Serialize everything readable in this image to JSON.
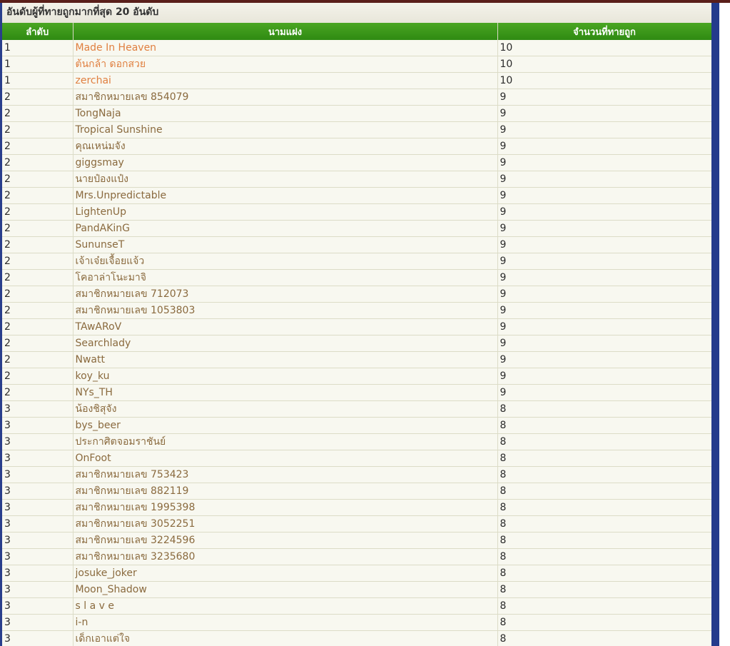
{
  "page": {
    "title": "อันดับผู้ที่ทายถูกมากที่สุด 20 อันดับ"
  },
  "table": {
    "headers": {
      "rank": "ลำดับ",
      "name": "นามแฝง",
      "count": "จำนวนที่ทายถูก"
    },
    "rows": [
      {
        "rank": "1",
        "name": "Made In Heaven",
        "count": "10",
        "highlight": true
      },
      {
        "rank": "1",
        "name": "ต้นกล้า ดอกสวย",
        "count": "10",
        "highlight": true
      },
      {
        "rank": "1",
        "name": "zerchai",
        "count": "10",
        "highlight": true
      },
      {
        "rank": "2",
        "name": "สมาชิกหมายเลข 854079",
        "count": "9"
      },
      {
        "rank": "2",
        "name": "TongNaja",
        "count": "9"
      },
      {
        "rank": "2",
        "name": "Tropical Sunshine",
        "count": "9"
      },
      {
        "rank": "2",
        "name": "คุณเหน่มจัง",
        "count": "9"
      },
      {
        "rank": "2",
        "name": "giggsmay",
        "count": "9"
      },
      {
        "rank": "2",
        "name": "นายป๋องแป๋ง",
        "count": "9"
      },
      {
        "rank": "2",
        "name": "Mrs.Unpredictable",
        "count": "9"
      },
      {
        "rank": "2",
        "name": "LightenUp",
        "count": "9"
      },
      {
        "rank": "2",
        "name": "PandAKinG",
        "count": "9"
      },
      {
        "rank": "2",
        "name": "SununseT",
        "count": "9"
      },
      {
        "rank": "2",
        "name": "เจ้าเจ๋ยเจื้อยแจ้ว",
        "count": "9"
      },
      {
        "rank": "2",
        "name": "โคอาล่าโนะมาจิ",
        "count": "9"
      },
      {
        "rank": "2",
        "name": "สมาชิกหมายเลข 712073",
        "count": "9"
      },
      {
        "rank": "2",
        "name": "สมาชิกหมายเลข 1053803",
        "count": "9"
      },
      {
        "rank": "2",
        "name": "TAwARoV",
        "count": "9"
      },
      {
        "rank": "2",
        "name": "Searchlady",
        "count": "9"
      },
      {
        "rank": "2",
        "name": "Nwatt",
        "count": "9"
      },
      {
        "rank": "2",
        "name": "koy_ku",
        "count": "9"
      },
      {
        "rank": "2",
        "name": "NYs_TH",
        "count": "9"
      },
      {
        "rank": "3",
        "name": "น้องชิสุจัง",
        "count": "8"
      },
      {
        "rank": "3",
        "name": "bys_beer",
        "count": "8"
      },
      {
        "rank": "3",
        "name": "ประกาศิตจอมราชันย์",
        "count": "8"
      },
      {
        "rank": "3",
        "name": "OnFoot",
        "count": "8"
      },
      {
        "rank": "3",
        "name": "สมาชิกหมายเลข 753423",
        "count": "8"
      },
      {
        "rank": "3",
        "name": "สมาชิกหมายเลข 882119",
        "count": "8"
      },
      {
        "rank": "3",
        "name": "สมาชิกหมายเลข 1995398",
        "count": "8"
      },
      {
        "rank": "3",
        "name": "สมาชิกหมายเลข 3052251",
        "count": "8"
      },
      {
        "rank": "3",
        "name": "สมาชิกหมายเลข 3224596",
        "count": "8"
      },
      {
        "rank": "3",
        "name": "สมาชิกหมายเลข 3235680",
        "count": "8"
      },
      {
        "rank": "3",
        "name": "josuke_joker",
        "count": "8"
      },
      {
        "rank": "3",
        "name": "Moon_Shadow",
        "count": "8"
      },
      {
        "rank": "3",
        "name": "s l a v e",
        "count": "8"
      },
      {
        "rank": "3",
        "name": "i-n",
        "count": "8"
      },
      {
        "rank": "3",
        "name": "เด็กเอาแต่ใจ",
        "count": "8"
      }
    ]
  },
  "colors": {
    "header_green": "#3c9a1b",
    "highlight_name": "#e07f3f",
    "name_text": "#8a6a3e",
    "side_bar_blue": "#243b8c"
  }
}
